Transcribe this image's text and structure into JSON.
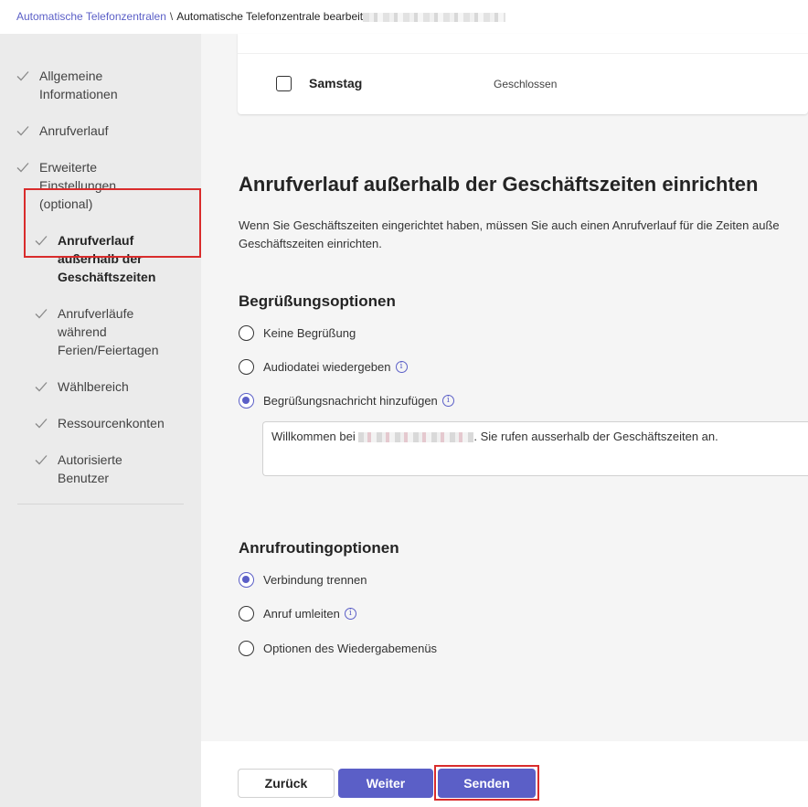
{
  "breadcrumb": {
    "parent": "Automatische Telefonzentralen",
    "separator": "\\",
    "current": "Automatische Telefonzentrale bearbeit"
  },
  "sidebar": {
    "steps": [
      {
        "label": "Allgemeine Informationen",
        "completed": true
      },
      {
        "label": "Anrufverlauf",
        "completed": true
      },
      {
        "label": "Erweiterte Einstellungen (optional)",
        "completed": true
      },
      {
        "label": "Anrufverlauf außerhalb der Geschäftszeiten",
        "completed": true,
        "active": true
      },
      {
        "label": "Anrufverläufe während Ferien/Feiertagen",
        "completed": true
      },
      {
        "label": "Wählbereich",
        "completed": true
      },
      {
        "label": "Ressourcenkonten",
        "completed": true
      },
      {
        "label": "Autorisierte Benutzer",
        "completed": true
      }
    ]
  },
  "schedule": {
    "day": "Samstag",
    "status": "Geschlossen",
    "checked": false
  },
  "main": {
    "title": "Anrufverlauf außerhalb der Geschäftszeiten einrichten",
    "description": "Wenn Sie Geschäftszeiten eingerichtet haben, müssen Sie auch einen Anrufverlauf für die Zeiten auße Geschäftszeiten einrichten.",
    "greeting": {
      "heading": "Begrüßungsoptionen",
      "options": [
        {
          "label": "Keine Begrüßung",
          "selected": false
        },
        {
          "label": "Audiodatei wiedergeben",
          "selected": false,
          "info": true
        },
        {
          "label": "Begrüßungsnachricht hinzufügen",
          "selected": true,
          "info": true
        }
      ],
      "message_prefix": "Willkommen bei",
      "message_suffix": ". Sie rufen ausserhalb der Geschäftszeiten an."
    },
    "routing": {
      "heading": "Anrufroutingoptionen",
      "options": [
        {
          "label": "Verbindung trennen",
          "selected": true
        },
        {
          "label": "Anruf umleiten",
          "selected": false,
          "info": true
        },
        {
          "label": "Optionen des Wiedergabemenüs",
          "selected": false
        }
      ]
    }
  },
  "footer": {
    "back_label": "Zurück",
    "next_label": "Weiter",
    "send_label": "Senden"
  },
  "colors": {
    "accent": "#5b5fc7",
    "highlight": "#d92c2c",
    "sidebar_bg": "#ebebeb"
  },
  "icons": {
    "step_check": "checkmark-icon",
    "info": "info-icon"
  }
}
